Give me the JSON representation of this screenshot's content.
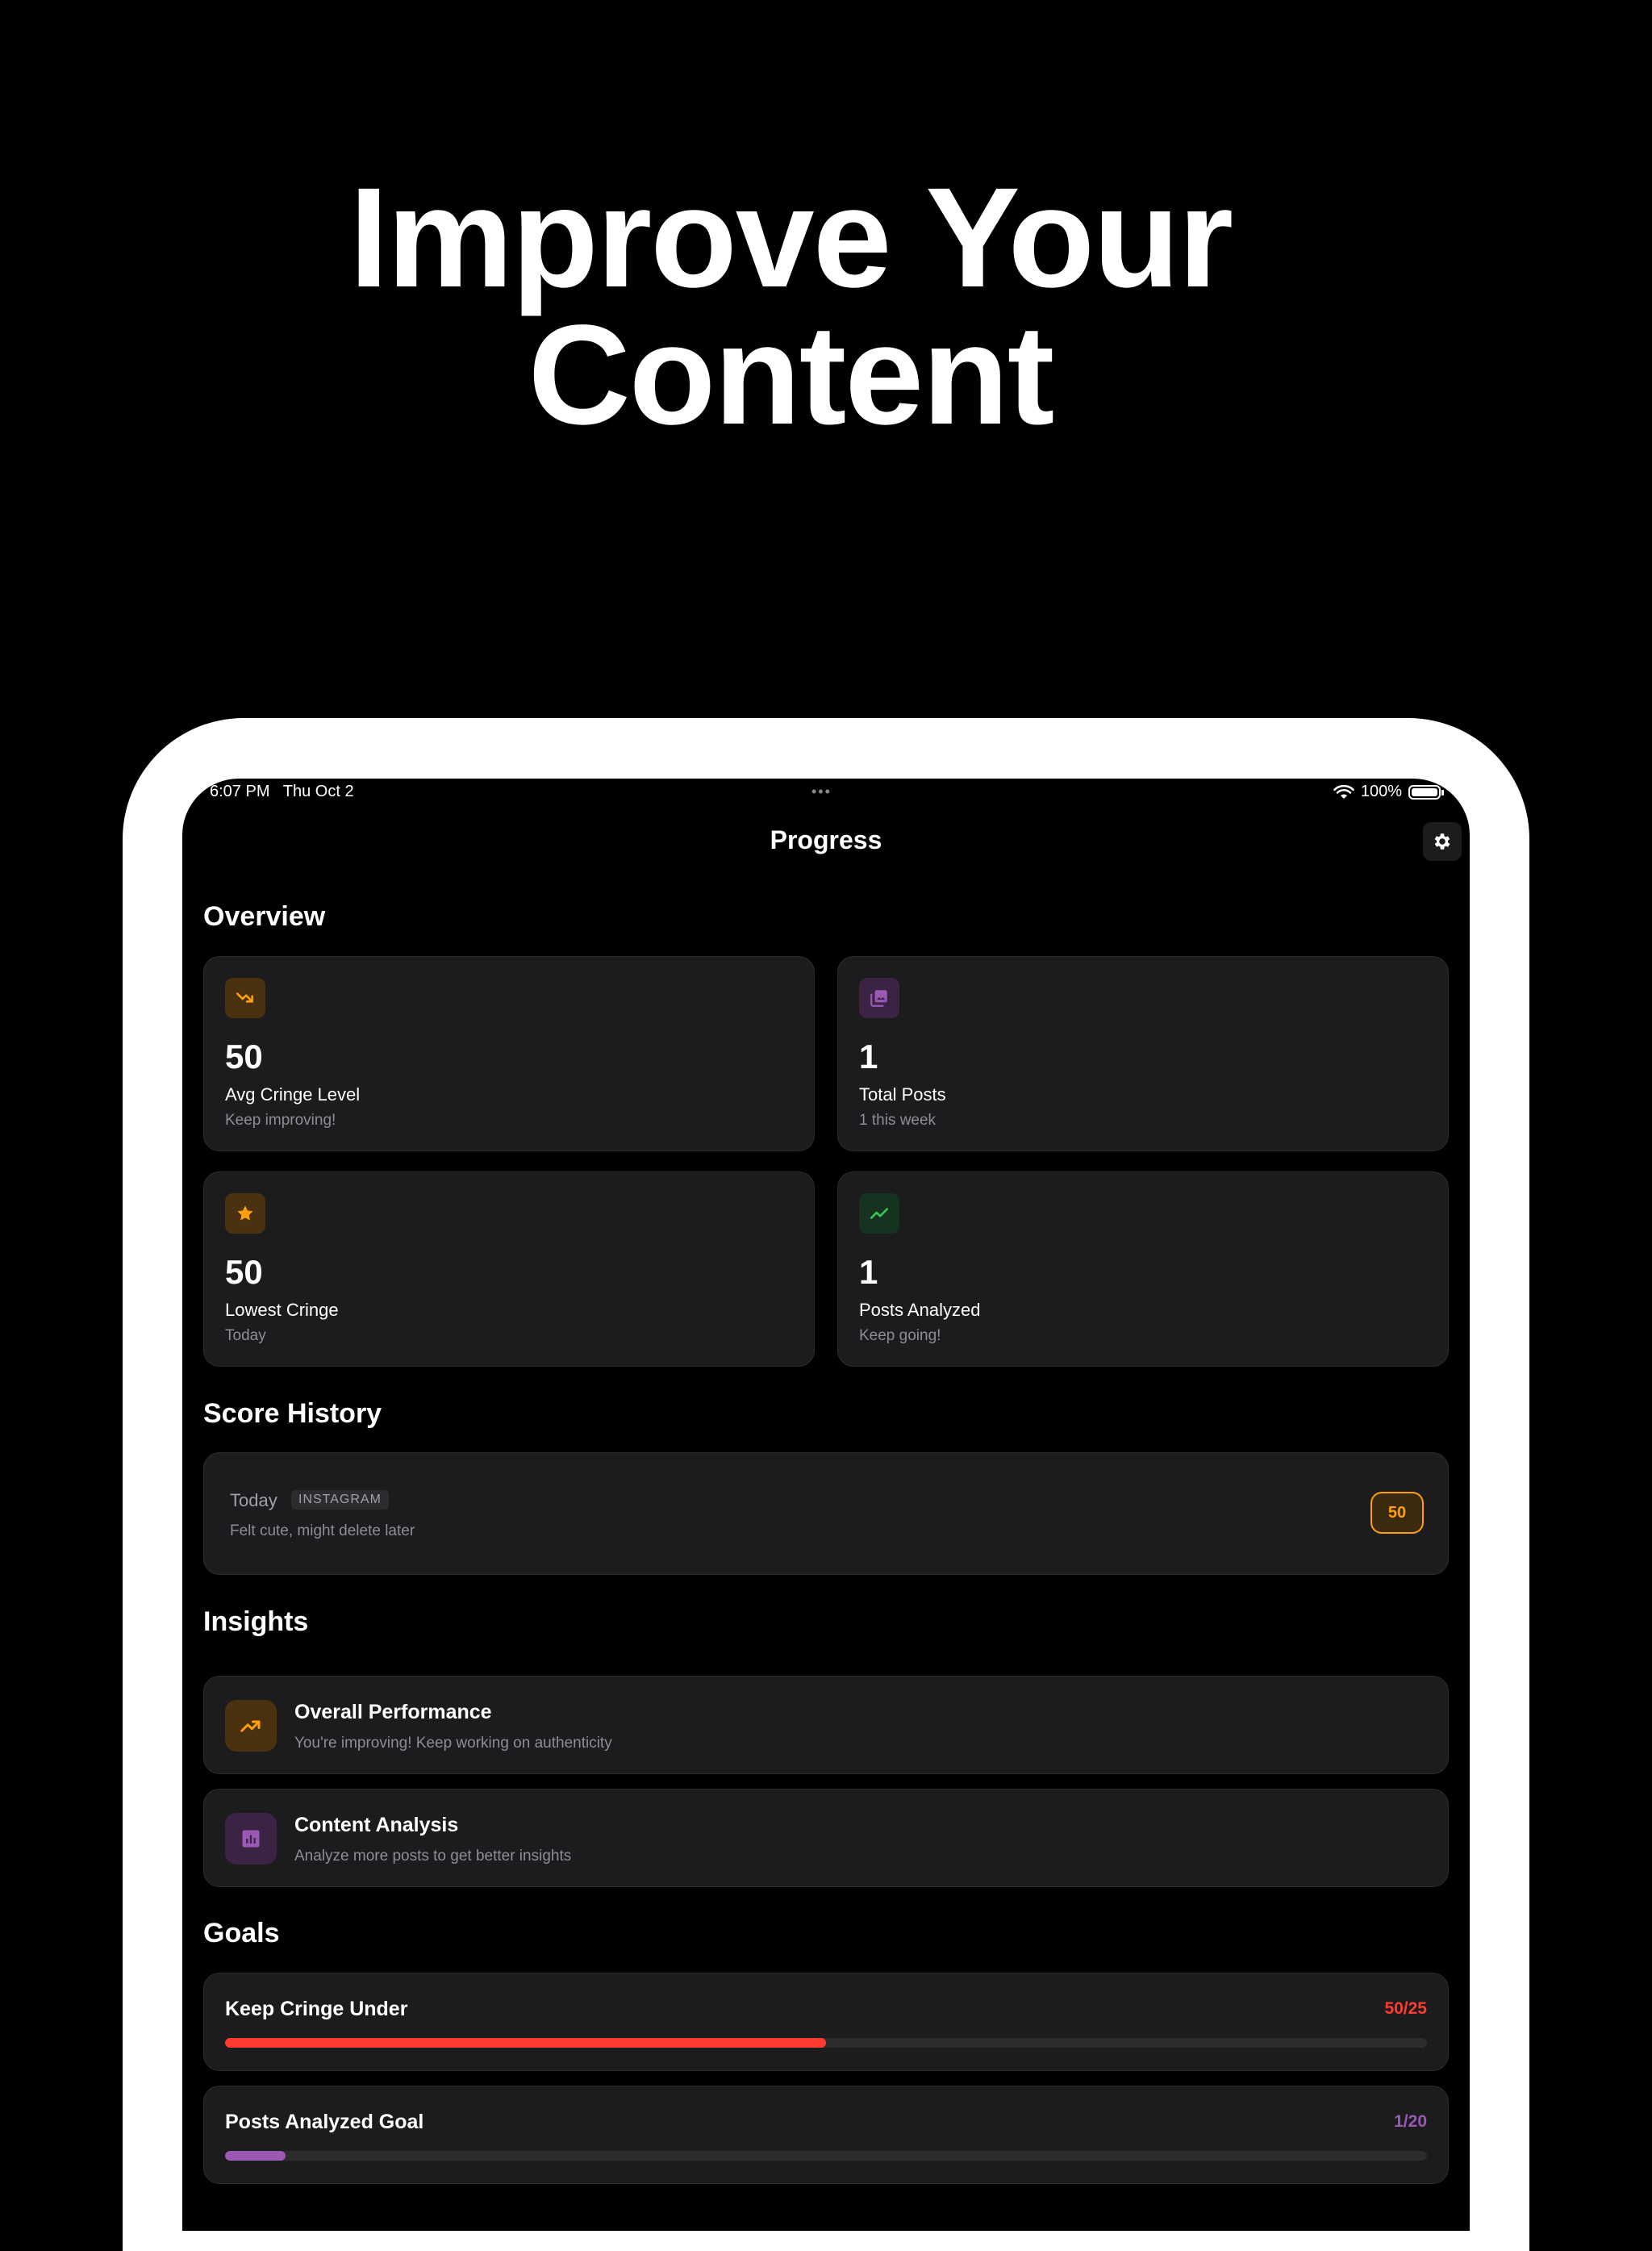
{
  "hero": {
    "line1": "Improve Your",
    "line2": "Content"
  },
  "status_bar": {
    "time": "6:07 PM   Thu Oct 2",
    "dots": "•••",
    "battery": "100%"
  },
  "nav": {
    "title": "Progress",
    "settings_icon": "gear-icon"
  },
  "overview": {
    "title": "Overview",
    "stats": [
      {
        "icon": "trending-down-icon",
        "value": "50",
        "label": "Avg Cringe Level",
        "sub": "Keep improving!",
        "color": "#ff9f0a"
      },
      {
        "icon": "photo-library-icon",
        "value": "1",
        "label": "Total Posts",
        "sub": "1 this week",
        "color": "#9b59b6"
      },
      {
        "icon": "star-icon",
        "value": "50",
        "label": "Lowest Cringe",
        "sub": "Today",
        "color": "#ff9f0a"
      },
      {
        "icon": "trending-up-icon",
        "value": "1",
        "label": "Posts Analyzed",
        "sub": "Keep going!",
        "color": "#34c759"
      }
    ]
  },
  "score_history": {
    "title": "Score History",
    "entries": [
      {
        "date": "Today",
        "platform": "INSTAGRAM",
        "caption": "Felt cute, might delete later",
        "score": "50"
      }
    ]
  },
  "insights": {
    "title": "Insights",
    "items": [
      {
        "icon": "trending-up-icon",
        "title": "Overall Performance",
        "desc": "You're improving! Keep working on authenticity",
        "color": "#ff9f0a"
      },
      {
        "icon": "bar-chart-icon",
        "title": "Content Analysis",
        "desc": "Analyze more posts to get better insights",
        "color": "#9b59b6"
      }
    ]
  },
  "goals": {
    "title": "Goals",
    "items": [
      {
        "title": "Keep Cringe Under",
        "value": "50/25",
        "progress": 0.5,
        "color": "#ff3b30"
      },
      {
        "title": "Posts Analyzed Goal",
        "value": "1/20",
        "progress": 0.05,
        "color": "#9b59b6"
      }
    ]
  }
}
